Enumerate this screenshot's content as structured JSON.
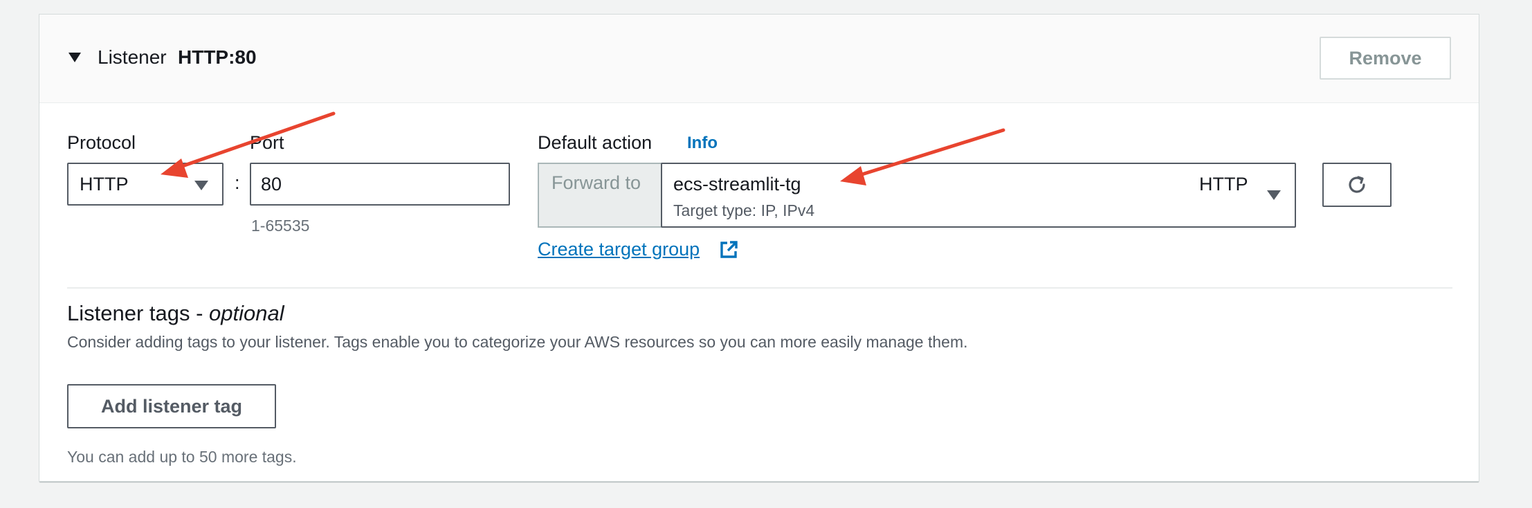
{
  "listener": {
    "label": "Listener",
    "name": "HTTP:80",
    "remove_label": "Remove"
  },
  "protocol": {
    "label": "Protocol",
    "value": "HTTP"
  },
  "port": {
    "label": "Port",
    "value": "80",
    "hint": "1-65535",
    "separator": ":"
  },
  "default_action": {
    "label": "Default action",
    "info_label": "Info",
    "forward_label": "Forward to",
    "target_group": "ecs-streamlit-tg",
    "target_type": "Target type: IP, IPv4",
    "target_protocol": "HTTP",
    "create_link": "Create target group"
  },
  "tags": {
    "title": "Listener tags - ",
    "title_optional": "optional",
    "description": "Consider adding tags to your listener. Tags enable you to categorize your AWS resources so you can more easily manage them.",
    "add_label": "Add listener tag",
    "limit_hint": "You can add up to 50 more tags."
  },
  "colors": {
    "link": "#0073bb",
    "annotation_arrow": "#e8442f",
    "border": "#545b64"
  },
  "icons": {
    "collapse": "caret-down-icon",
    "refresh": "refresh-icon",
    "external": "external-link-icon"
  }
}
